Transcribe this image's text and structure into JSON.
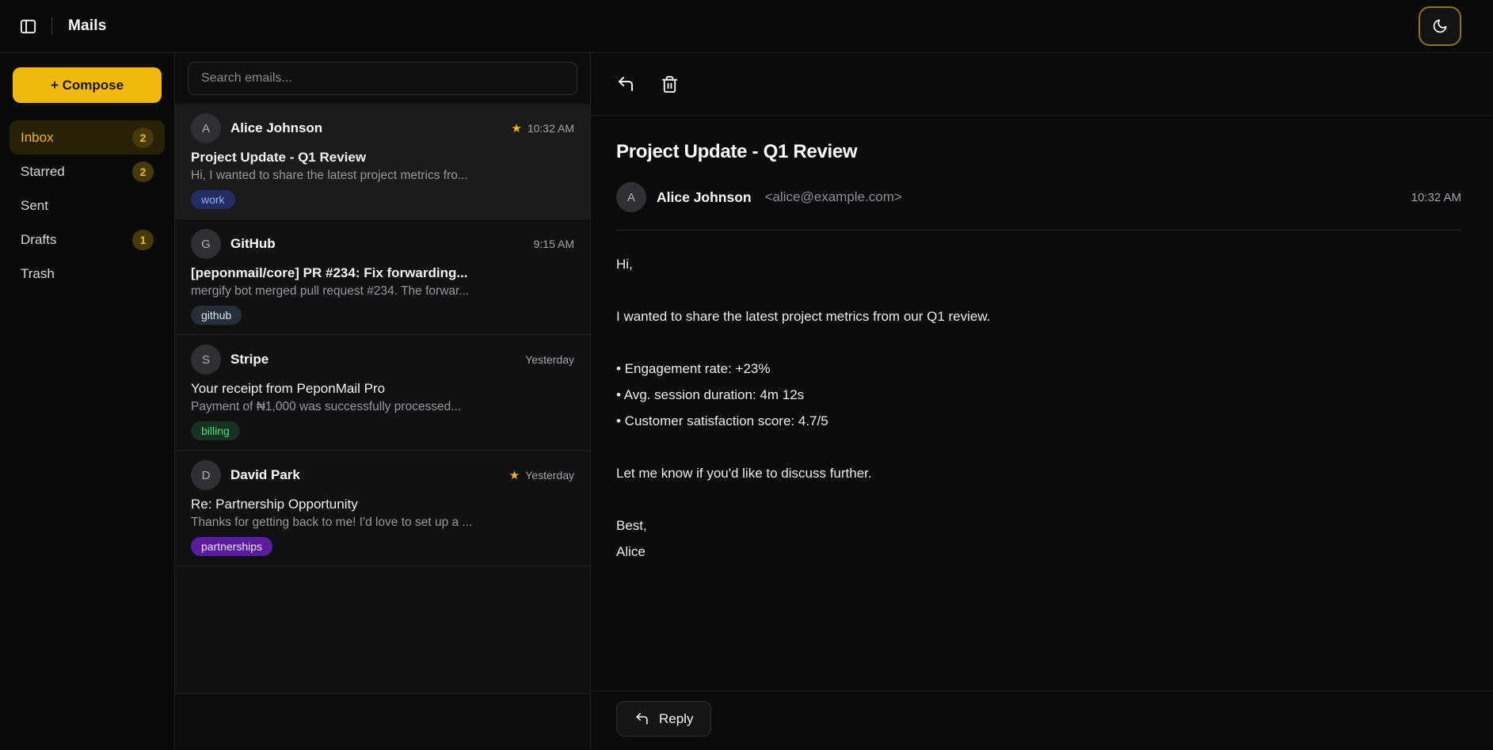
{
  "header": {
    "title": "Mails"
  },
  "theme": {
    "accent": "#f0b90b",
    "star": "#f5b60d"
  },
  "sidebar": {
    "compose_label": "+ Compose",
    "items": [
      {
        "label": "Inbox",
        "badge": "2",
        "active": true
      },
      {
        "label": "Starred",
        "badge": "2",
        "active": false
      },
      {
        "label": "Sent",
        "badge": "",
        "active": false
      },
      {
        "label": "Drafts",
        "badge": "1",
        "active": false
      },
      {
        "label": "Trash",
        "badge": "",
        "active": false
      }
    ]
  },
  "email_list": {
    "search_placeholder": "Search emails...",
    "emails": [
      {
        "avatar": "A",
        "sender": "Alice Johnson",
        "time": "10:32 AM",
        "starred": true,
        "unread": true,
        "selected": true,
        "subject": "Project Update - Q1 Review",
        "preview": "Hi, I wanted to share the latest project metrics fro...",
        "tag": "work",
        "tag_bg": "#222e63",
        "tag_color": "#8fb0f4"
      },
      {
        "avatar": "G",
        "sender": "GitHub",
        "time": "9:15 AM",
        "starred": false,
        "unread": true,
        "selected": false,
        "subject": "[peponmail/core] PR #234: Fix forwarding...",
        "preview": "mergify bot merged pull request #234. The forwar...",
        "tag": "github",
        "tag_bg": "#262e3a",
        "tag_color": "#dde2e8"
      },
      {
        "avatar": "S",
        "sender": "Stripe",
        "time": "Yesterday",
        "starred": false,
        "unread": false,
        "selected": false,
        "subject": "Your receipt from PeponMail Pro",
        "preview": "Payment of ₦1,000 was successfully processed...",
        "tag": "billing",
        "tag_bg": "#173122",
        "tag_color": "#4ade80"
      },
      {
        "avatar": "D",
        "sender": "David Park",
        "time": "Yesterday",
        "starred": true,
        "unread": false,
        "selected": false,
        "subject": "Re: Partnership Opportunity",
        "preview": "Thanks for getting back to me! I'd love to set up a ...",
        "tag": "partnerships",
        "tag_bg": "#5a1d9e",
        "tag_color": "#efe2fd"
      }
    ]
  },
  "detail": {
    "subject": "Project Update - Q1 Review",
    "avatar": "A",
    "sender_name": "Alice Johnson",
    "sender_email": "<alice@example.com>",
    "time": "10:32 AM",
    "body": "Hi,\n\nI wanted to share the latest project metrics from our Q1 review.\n\n• Engagement rate: +23%\n• Avg. session duration: 4m 12s\n• Customer satisfaction score: 4.7/5\n\nLet me know if you'd like to discuss further.\n\nBest,\nAlice",
    "reply_label": "Reply"
  }
}
